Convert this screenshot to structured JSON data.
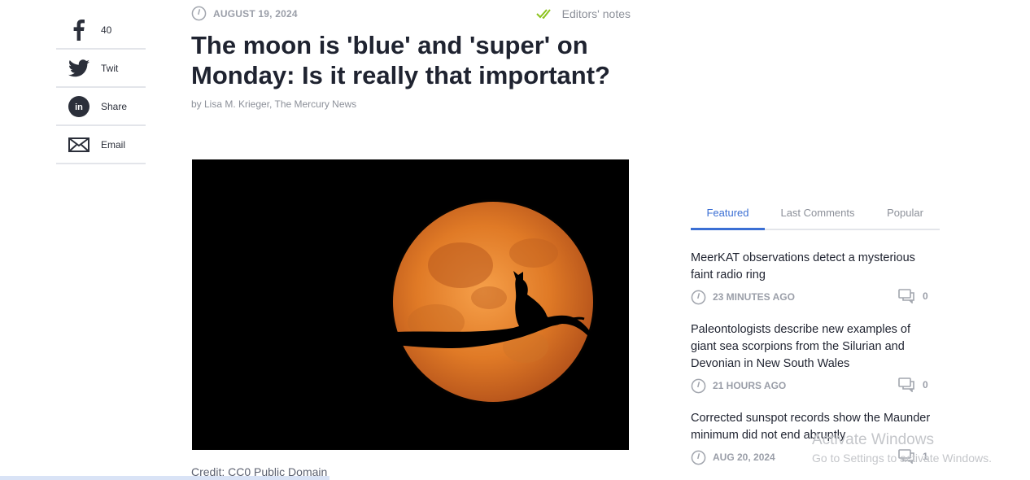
{
  "share": {
    "facebook": {
      "icon": "facebook-icon",
      "label": "40"
    },
    "twitter": {
      "icon": "twitter-icon",
      "label": "Twit"
    },
    "linkedin": {
      "icon": "linkedin-icon",
      "label": "Share"
    },
    "email": {
      "icon": "email-icon",
      "label": "Email"
    }
  },
  "article": {
    "date": "AUGUST 19, 2024",
    "editors_notes": "Editors' notes",
    "headline": "The moon is 'blue' and 'super' on Monday: Is it really that important?",
    "byline": "by Lisa M. Krieger, The Mercury News",
    "image_alt": "Orange full moon with cat silhouette on a branch",
    "credit": "Credit: CC0 Public Domain"
  },
  "panel": {
    "tabs": [
      "Featured",
      "Last Comments",
      "Popular"
    ],
    "active_tab": "Featured",
    "items": [
      {
        "title": "MeerKAT observations detect a mysterious faint radio ring",
        "time": "23 MINUTES AGO",
        "comments": "0"
      },
      {
        "title": "Paleontologists describe new examples of giant sea scorpions from the Silurian and Devonian in New South Wales",
        "time": "21 HOURS AGO",
        "comments": "0"
      },
      {
        "title": "Corrected sunspot records show the Maunder minimum did not end abruptly",
        "time": "AUG 20, 2024",
        "comments": "1"
      }
    ]
  },
  "watermark": {
    "title": "Activate Windows",
    "subtitle": "Go to Settings to activate Windows."
  },
  "reading_progress": 0.32,
  "colors": {
    "accent": "#3b6fd4",
    "check": "#8cc31e",
    "icon_dark": "#2b2f3a"
  }
}
